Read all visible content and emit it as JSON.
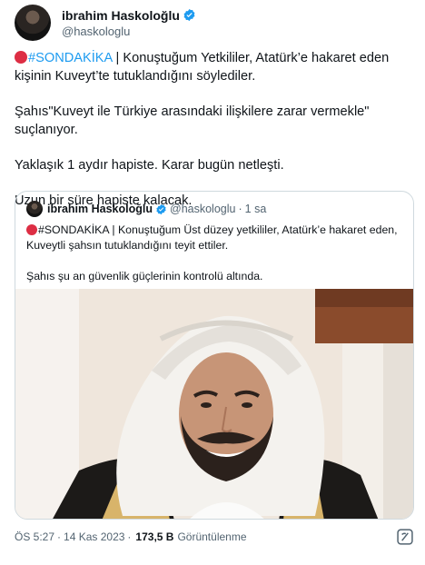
{
  "author": {
    "display_name": "ibrahim Haskoloğlu",
    "handle": "@haskologlu"
  },
  "tweet": {
    "line1_hashtag": "#SONDAKİKA",
    "line1_rest": " | Konuştuğum Yetkililer, Atatürk’e hakaret eden kişinin Kuveyt’te tutuklandığını söylediler.",
    "para2": "Şahıs\"Kuveyt ile Türkiye arasındaki ilişkilere zarar vermekle\" suçlanıyor.",
    "para3": "Yaklaşık 1 aydır hapiste. Karar bugün netleşti.",
    "para4": "Uzun bir süre hapiste kalacak."
  },
  "quoted": {
    "display_name": "ibrahim Haskoloğlu",
    "handle": "@haskologlu",
    "separator": "·",
    "time": "1 sa",
    "hashtag": "#SONDAKİKA",
    "line1_rest": " | Konuştuğum Üst düzey yetkililer,  Atatürk’e hakaret eden, Kuveytli şahsın tutuklandığını teyit ettiler.",
    "para2": "Şahıs şu an güvenlik güçlerinin kontrolü altında."
  },
  "footer": {
    "time": "ÖS 5:27",
    "dot": "·",
    "date": "14 Kas 2023",
    "views_count": "173,5 B",
    "views_label": "Görüntülenme"
  },
  "icons": {
    "verified": "verified-badge-icon",
    "bookmark": "bookmark-icon"
  },
  "colors": {
    "link": "#1d9bf0",
    "verified": "#1d9bf0",
    "muted": "#536471",
    "alert": "#dd2e44"
  }
}
